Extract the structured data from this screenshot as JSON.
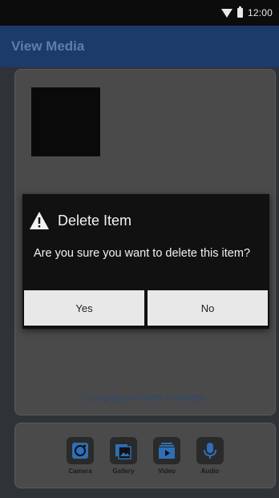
{
  "status_bar": {
    "time": "12:00"
  },
  "app_bar": {
    "title": "View Media"
  },
  "media": {
    "hint": "Long-tap an item to delete"
  },
  "toolbar": {
    "items": [
      {
        "label": "Camera",
        "icon": "camera-icon"
      },
      {
        "label": "Gallery",
        "icon": "gallery-icon"
      },
      {
        "label": "Video",
        "icon": "video-icon"
      },
      {
        "label": "Audio",
        "icon": "microphone-icon"
      }
    ]
  },
  "dialog": {
    "title": "Delete Item",
    "message": "Are you sure you want to delete this item?",
    "yes_label": "Yes",
    "no_label": "No",
    "icon": "warning-icon"
  },
  "colors": {
    "accent": "#1c3a6a",
    "icon_blue": "#2f6fb5"
  }
}
